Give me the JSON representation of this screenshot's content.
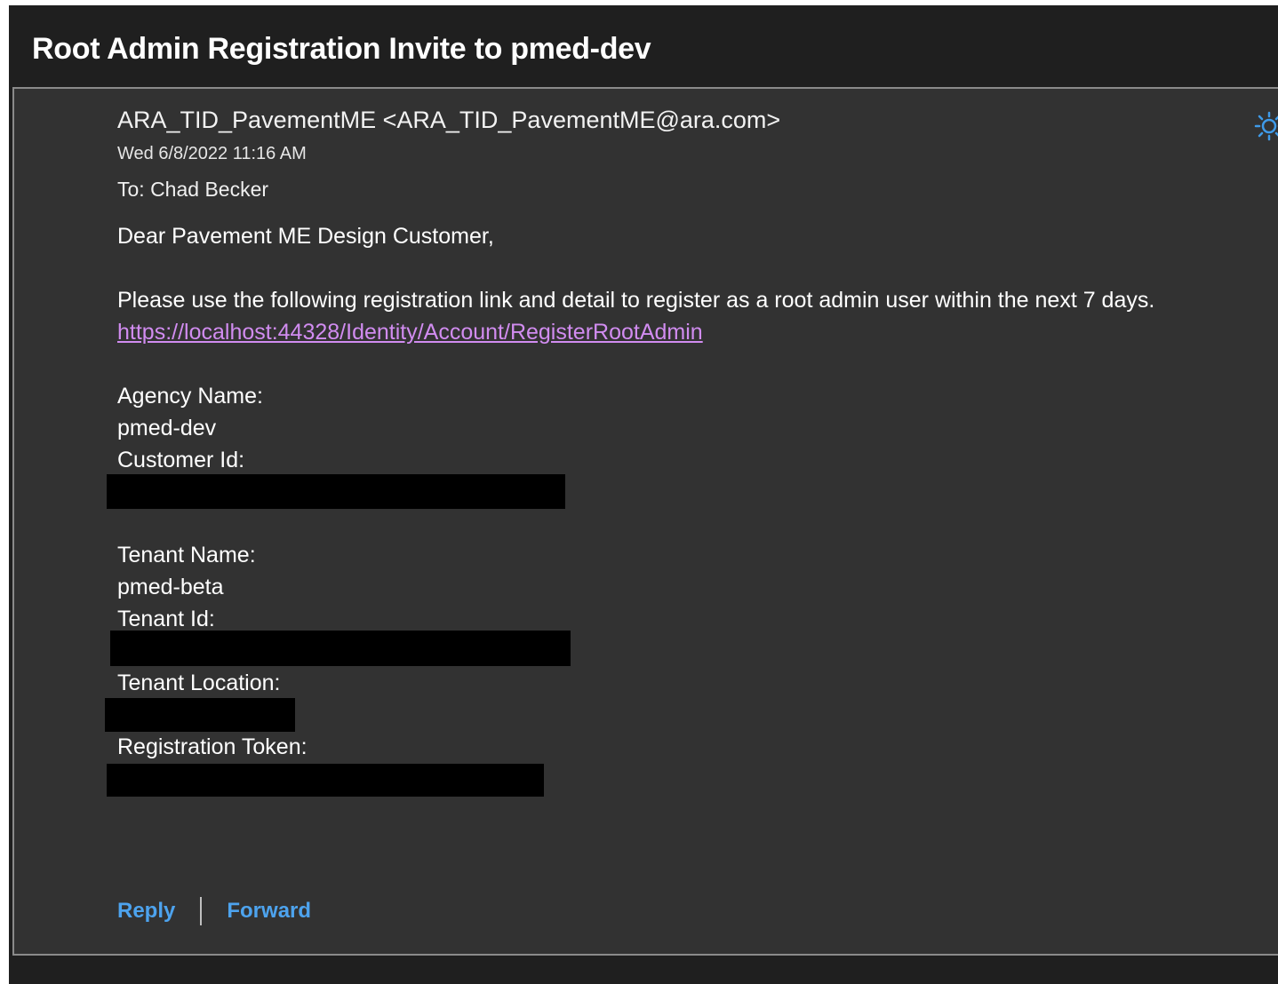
{
  "email": {
    "subject": "Root Admin Registration Invite to pmed-dev",
    "sender": "ARA_TID_PavementME <ARA_TID_PavementME@ara.com>",
    "date": "Wed 6/8/2022 11:16 AM",
    "to": "To: Chad Becker",
    "greeting": "Dear Pavement ME Design Customer,",
    "instructions": "Please use the following registration link and detail to register as a root admin user within the next 7 days.",
    "link": "https://localhost:44328/Identity/Account/RegisterRootAdmin",
    "fields": {
      "agency_name_label": "Agency Name:",
      "agency_name_value": "pmed-dev",
      "customer_id_label": "Customer Id:",
      "tenant_name_label": "Tenant Name:",
      "tenant_name_value": "pmed-beta",
      "tenant_id_label": "Tenant Id:",
      "tenant_location_label": "Tenant Location:",
      "registration_token_label": "Registration Token:"
    }
  },
  "actions": {
    "reply_label": "Reply",
    "forward_label": "Forward"
  },
  "icons": {
    "top_right": "sun-icon"
  },
  "colors": {
    "background": "#1f1f1f",
    "panel": "#323232",
    "link": "#d18cf0",
    "action": "#4da3ee",
    "icon": "#3f9ae8"
  }
}
